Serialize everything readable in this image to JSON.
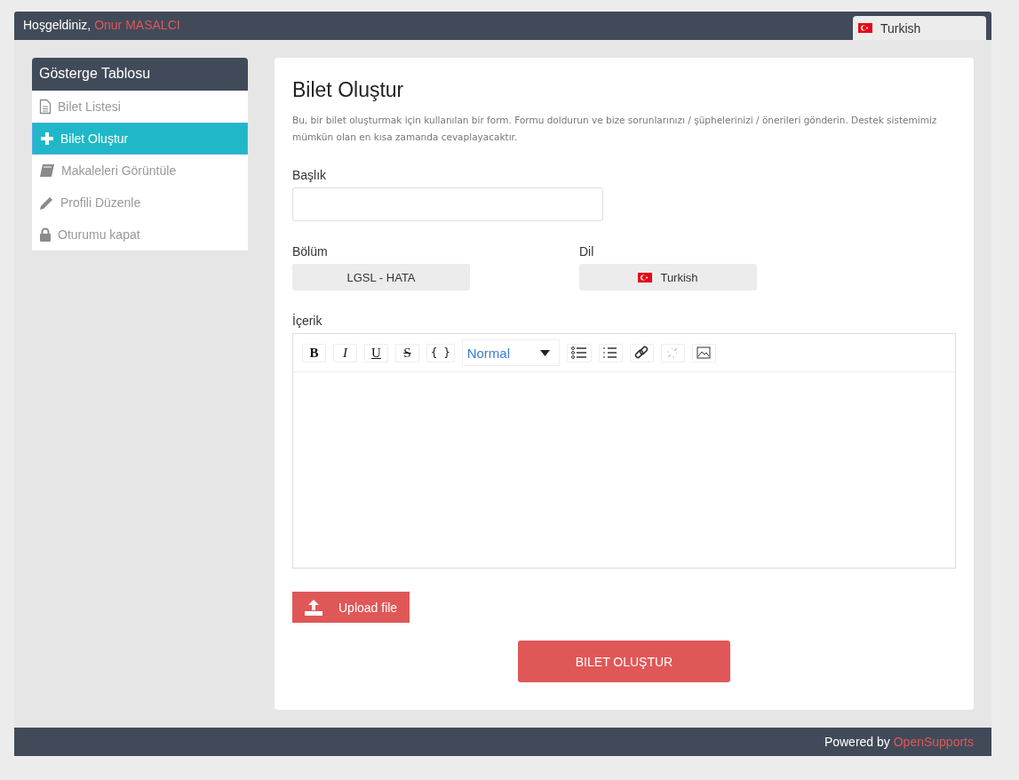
{
  "header": {
    "greeting": "Hoşgeldiniz,",
    "user": "Onur MASALCI",
    "language": "Turkish"
  },
  "sidebar": {
    "title": "Gösterge Tablosu",
    "items": [
      {
        "label": "Bilet Listesi",
        "kind": "document",
        "selected": false
      },
      {
        "label": "Bilet Oluştur",
        "kind": "plus",
        "selected": true
      },
      {
        "label": "Makaleleri Görüntüle",
        "kind": "book",
        "selected": false
      },
      {
        "label": "Profili Düzenle",
        "kind": "pencil",
        "selected": false
      },
      {
        "label": "Oturumu kapat",
        "kind": "lock",
        "selected": false
      }
    ]
  },
  "form": {
    "title": "Bilet Oluştur",
    "description": "Bu, bir bilet oluşturmak için kullanılan bir form. Formu doldurun ve bize sorunlarınızı / şüphelerinizi / önerileri gönderin. Destek sistemimiz mümkün olan en kısa zamanda cevaplayacaktır.",
    "title_label": "Başlık",
    "department_label": "Bölüm",
    "department": "LGSL - HATA",
    "language_label": "Dil",
    "language": "Turkish",
    "content_label": "İçerik",
    "toolbar": [
      {
        "kind": "bold",
        "text": "B"
      },
      {
        "kind": "italic",
        "text": "I"
      },
      {
        "kind": "underline",
        "text": "U"
      },
      {
        "kind": "strike",
        "text": "S"
      },
      {
        "kind": "code",
        "text": "{ }"
      },
      {
        "kind": "select",
        "text": "Normal"
      },
      {
        "kind": "bullets",
        "disabled": false
      },
      {
        "kind": "numbers",
        "disabled": false
      },
      {
        "kind": "link",
        "disabled": false
      },
      {
        "kind": "unlink",
        "disabled": true
      },
      {
        "kind": "image",
        "disabled": false
      }
    ],
    "upload": "Upload file",
    "submit": "BILET OLUŞTUR"
  },
  "footer": {
    "prefix": "Powered by",
    "brand": "OpenSupports"
  }
}
